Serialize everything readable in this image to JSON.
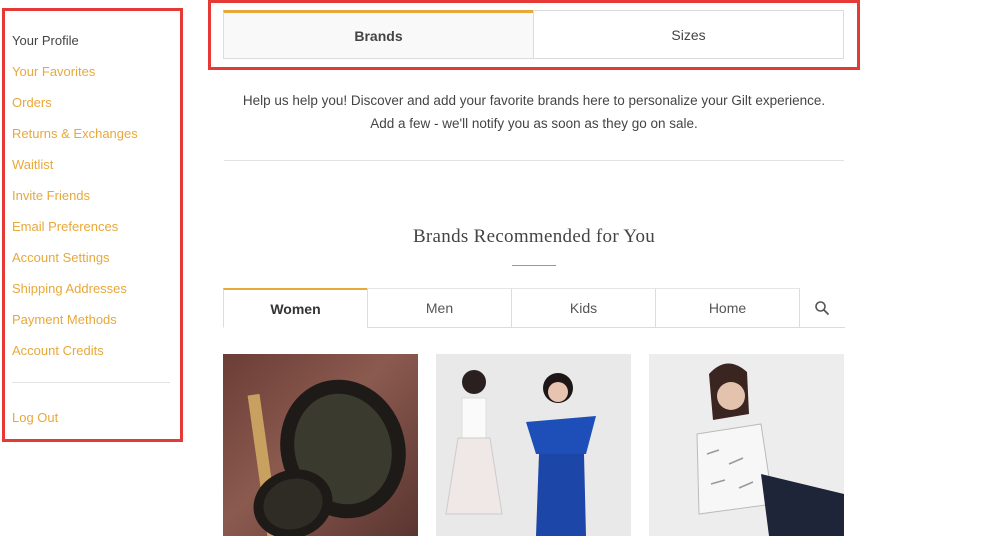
{
  "sidebar": {
    "items": [
      {
        "label": "Your Profile",
        "active": true
      },
      {
        "label": "Your Favorites"
      },
      {
        "label": "Orders"
      },
      {
        "label": "Returns & Exchanges"
      },
      {
        "label": "Waitlist"
      },
      {
        "label": "Invite Friends"
      },
      {
        "label": "Email Preferences"
      },
      {
        "label": "Account Settings"
      },
      {
        "label": "Shipping Addresses"
      },
      {
        "label": "Payment Methods"
      },
      {
        "label": "Account Credits"
      }
    ],
    "logout": "Log Out"
  },
  "tabs": {
    "brands": "Brands",
    "sizes": "Sizes"
  },
  "intro": {
    "line1": "Help us help you! Discover and add your favorite brands here to personalize your Gilt experience.",
    "line2": "Add a few - we'll notify you as soon as they go on sale."
  },
  "recommended": {
    "title": "Brands Recommended for You",
    "categories": [
      "Women",
      "Men",
      "Kids",
      "Home"
    ],
    "active_category": "Women"
  },
  "colors": {
    "accent": "#e8a83a",
    "highlight_border": "#e53935"
  },
  "icons": {
    "search": "search-icon"
  }
}
